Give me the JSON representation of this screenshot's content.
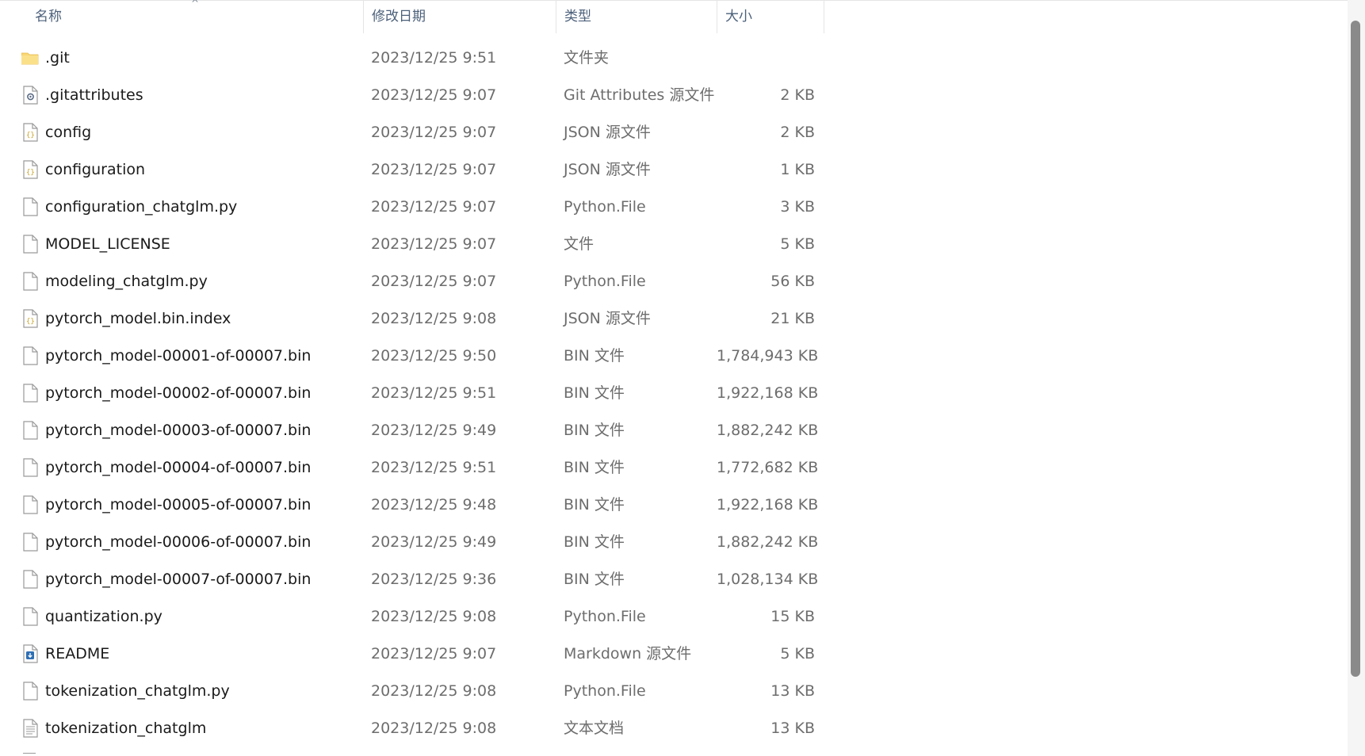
{
  "header": {
    "name": "名称",
    "date": "修改日期",
    "type": "类型",
    "size": "大小",
    "sort_indicator": "^"
  },
  "colors": {
    "header_text": "#4c607a",
    "row_text": "#1a1a1a",
    "meta_text": "#6d6d6d",
    "folder": "#f8d775",
    "scrollbar_thumb": "#8a8a8a"
  },
  "files": [
    {
      "name": ".git",
      "date": "2023/12/25 9:51",
      "type": "文件夹",
      "size": "",
      "icon": "folder-icon"
    },
    {
      "name": ".gitattributes",
      "date": "2023/12/25 9:07",
      "type": "Git Attributes 源文件",
      "size": "2 KB",
      "icon": "gear-file-icon"
    },
    {
      "name": "config",
      "date": "2023/12/25 9:07",
      "type": "JSON 源文件",
      "size": "2 KB",
      "icon": "json-file-icon"
    },
    {
      "name": "configuration",
      "date": "2023/12/25 9:07",
      "type": "JSON 源文件",
      "size": "1 KB",
      "icon": "json-file-icon"
    },
    {
      "name": "configuration_chatglm.py",
      "date": "2023/12/25 9:07",
      "type": "Python.File",
      "size": "3 KB",
      "icon": "blank-file-icon"
    },
    {
      "name": "MODEL_LICENSE",
      "date": "2023/12/25 9:07",
      "type": "文件",
      "size": "5 KB",
      "icon": "blank-file-icon"
    },
    {
      "name": "modeling_chatglm.py",
      "date": "2023/12/25 9:07",
      "type": "Python.File",
      "size": "56 KB",
      "icon": "blank-file-icon"
    },
    {
      "name": "pytorch_model.bin.index",
      "date": "2023/12/25 9:08",
      "type": "JSON 源文件",
      "size": "21 KB",
      "icon": "json-file-icon"
    },
    {
      "name": "pytorch_model-00001-of-00007.bin",
      "date": "2023/12/25 9:50",
      "type": "BIN 文件",
      "size": "1,784,943 KB",
      "icon": "blank-file-icon"
    },
    {
      "name": "pytorch_model-00002-of-00007.bin",
      "date": "2023/12/25 9:51",
      "type": "BIN 文件",
      "size": "1,922,168 KB",
      "icon": "blank-file-icon"
    },
    {
      "name": "pytorch_model-00003-of-00007.bin",
      "date": "2023/12/25 9:49",
      "type": "BIN 文件",
      "size": "1,882,242 KB",
      "icon": "blank-file-icon"
    },
    {
      "name": "pytorch_model-00004-of-00007.bin",
      "date": "2023/12/25 9:51",
      "type": "BIN 文件",
      "size": "1,772,682 KB",
      "icon": "blank-file-icon"
    },
    {
      "name": "pytorch_model-00005-of-00007.bin",
      "date": "2023/12/25 9:48",
      "type": "BIN 文件",
      "size": "1,922,168 KB",
      "icon": "blank-file-icon"
    },
    {
      "name": "pytorch_model-00006-of-00007.bin",
      "date": "2023/12/25 9:49",
      "type": "BIN 文件",
      "size": "1,882,242 KB",
      "icon": "blank-file-icon"
    },
    {
      "name": "pytorch_model-00007-of-00007.bin",
      "date": "2023/12/25 9:36",
      "type": "BIN 文件",
      "size": "1,028,134 KB",
      "icon": "blank-file-icon"
    },
    {
      "name": "quantization.py",
      "date": "2023/12/25 9:08",
      "type": "Python.File",
      "size": "15 KB",
      "icon": "blank-file-icon"
    },
    {
      "name": "README",
      "date": "2023/12/25 9:07",
      "type": "Markdown 源文件",
      "size": "5 KB",
      "icon": "markdown-file-icon"
    },
    {
      "name": "tokenization_chatglm.py",
      "date": "2023/12/25 9:08",
      "type": "Python.File",
      "size": "13 KB",
      "icon": "blank-file-icon"
    },
    {
      "name": "tokenization_chatglm",
      "date": "2023/12/25 9:08",
      "type": "文本文档",
      "size": "13 KB",
      "icon": "text-file-icon"
    }
  ]
}
